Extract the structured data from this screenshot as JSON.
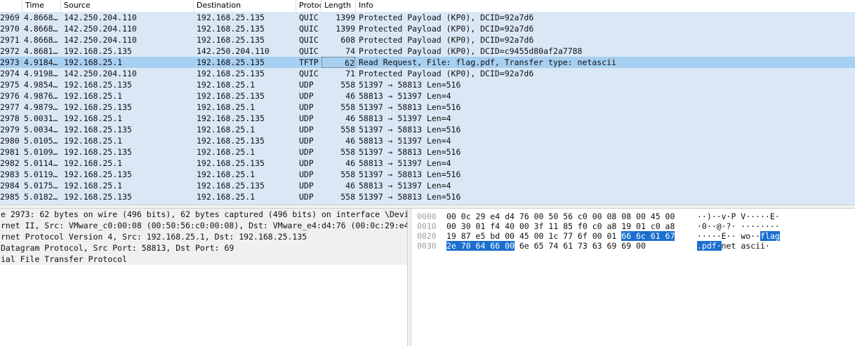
{
  "columns": {
    "time": "Time",
    "source": "Source",
    "destination": "Destination",
    "protocol": "Protoc",
    "length": "Length",
    "info": "Info"
  },
  "packets": [
    {
      "no": "2969",
      "time": "4.8668…",
      "src": "142.250.204.110",
      "dst": "192.168.25.135",
      "proto": "QUIC",
      "len": "1399",
      "info": "Protected Payload (KP0), DCID=92a7d6"
    },
    {
      "no": "2970",
      "time": "4.8668…",
      "src": "142.250.204.110",
      "dst": "192.168.25.135",
      "proto": "QUIC",
      "len": "1399",
      "info": "Protected Payload (KP0), DCID=92a7d6"
    },
    {
      "no": "2971",
      "time": "4.8668…",
      "src": "142.250.204.110",
      "dst": "192.168.25.135",
      "proto": "QUIC",
      "len": "608",
      "info": "Protected Payload (KP0), DCID=92a7d6"
    },
    {
      "no": "2972",
      "time": "4.8681…",
      "src": "192.168.25.135",
      "dst": "142.250.204.110",
      "proto": "QUIC",
      "len": "74",
      "info": "Protected Payload (KP0), DCID=c9455d80af2a7788"
    },
    {
      "no": "2973",
      "time": "4.9184…",
      "src": "192.168.25.1",
      "dst": "192.168.25.135",
      "proto": "TFTP",
      "len": "62",
      "info": "Read Request, File: flag.pdf, Transfer type: netascii"
    },
    {
      "no": "2974",
      "time": "4.9198…",
      "src": "142.250.204.110",
      "dst": "192.168.25.135",
      "proto": "QUIC",
      "len": "71",
      "info": "Protected Payload (KP0), DCID=92a7d6"
    },
    {
      "no": "2975",
      "time": "4.9854…",
      "src": "192.168.25.135",
      "dst": "192.168.25.1",
      "proto": "UDP",
      "len": "558",
      "info": "51397 → 58813 Len=516"
    },
    {
      "no": "2976",
      "time": "4.9876…",
      "src": "192.168.25.1",
      "dst": "192.168.25.135",
      "proto": "UDP",
      "len": "46",
      "info": "58813 → 51397 Len=4"
    },
    {
      "no": "2977",
      "time": "4.9879…",
      "src": "192.168.25.135",
      "dst": "192.168.25.1",
      "proto": "UDP",
      "len": "558",
      "info": "51397 → 58813 Len=516"
    },
    {
      "no": "2978",
      "time": "5.0031…",
      "src": "192.168.25.1",
      "dst": "192.168.25.135",
      "proto": "UDP",
      "len": "46",
      "info": "58813 → 51397 Len=4"
    },
    {
      "no": "2979",
      "time": "5.0034…",
      "src": "192.168.25.135",
      "dst": "192.168.25.1",
      "proto": "UDP",
      "len": "558",
      "info": "51397 → 58813 Len=516"
    },
    {
      "no": "2980",
      "time": "5.0105…",
      "src": "192.168.25.1",
      "dst": "192.168.25.135",
      "proto": "UDP",
      "len": "46",
      "info": "58813 → 51397 Len=4"
    },
    {
      "no": "2981",
      "time": "5.0109…",
      "src": "192.168.25.135",
      "dst": "192.168.25.1",
      "proto": "UDP",
      "len": "558",
      "info": "51397 → 58813 Len=516"
    },
    {
      "no": "2982",
      "time": "5.0114…",
      "src": "192.168.25.1",
      "dst": "192.168.25.135",
      "proto": "UDP",
      "len": "46",
      "info": "58813 → 51397 Len=4"
    },
    {
      "no": "2983",
      "time": "5.0119…",
      "src": "192.168.25.135",
      "dst": "192.168.25.1",
      "proto": "UDP",
      "len": "558",
      "info": "51397 → 58813 Len=516"
    },
    {
      "no": "2984",
      "time": "5.0175…",
      "src": "192.168.25.1",
      "dst": "192.168.25.135",
      "proto": "UDP",
      "len": "46",
      "info": "58813 → 51397 Len=4"
    },
    {
      "no": "2985",
      "time": "5.0182…",
      "src": "192.168.25.135",
      "dst": "192.168.25.1",
      "proto": "UDP",
      "len": "558",
      "info": "51397 → 58813 Len=516"
    }
  ],
  "selected_index": 4,
  "colors": {
    "row_bg": "#dae8f6",
    "selected_bg": "#a7cff1",
    "byte_highlight": "#1b6fce"
  },
  "details": [
    "e 2973: 62 bytes on wire (496 bits), 62 bytes captured (496 bits) on interface \\Devi",
    "rnet II, Src: VMware_c0:00:08 (00:50:56:c0:00:08), Dst: VMware_e4:d4:76 (00:0c:29:e4",
    "rnet Protocol Version 4, Src: 192.168.25.1, Dst: 192.168.25.135",
    " Datagram Protocol, Src Port: 58813, Dst Port: 69",
    "ial File Transfer Protocol"
  ],
  "bytes": [
    {
      "offset": "0000",
      "hex": "00 0c 29 e4 d4 76 00 50  56 c0 00 08 08 00 45 00",
      "ascii": "··)··v·P V·····E·"
    },
    {
      "offset": "0010",
      "hex": "00 30 01 f4 40 00 3f 11  85 f0 c0 a8 19 01 c0 a8",
      "ascii": "·0··@·?· ········"
    },
    {
      "offset": "0020",
      "hex_plain": "19 87 e5 bd 00 45 00 1c  77 6f 00 01 ",
      "hex_hl": "66 6c 61 67",
      "ascii_plain": "·····E·· wo··",
      "ascii_hl": "flag"
    },
    {
      "offset": "0030",
      "hex_hl": "2e 70 64 66 00",
      "hex_plain": " 6e 65 74  61 73 63 69 69 00",
      "ascii_hl": ".pdf·",
      "ascii_plain": "net ascii·"
    }
  ]
}
